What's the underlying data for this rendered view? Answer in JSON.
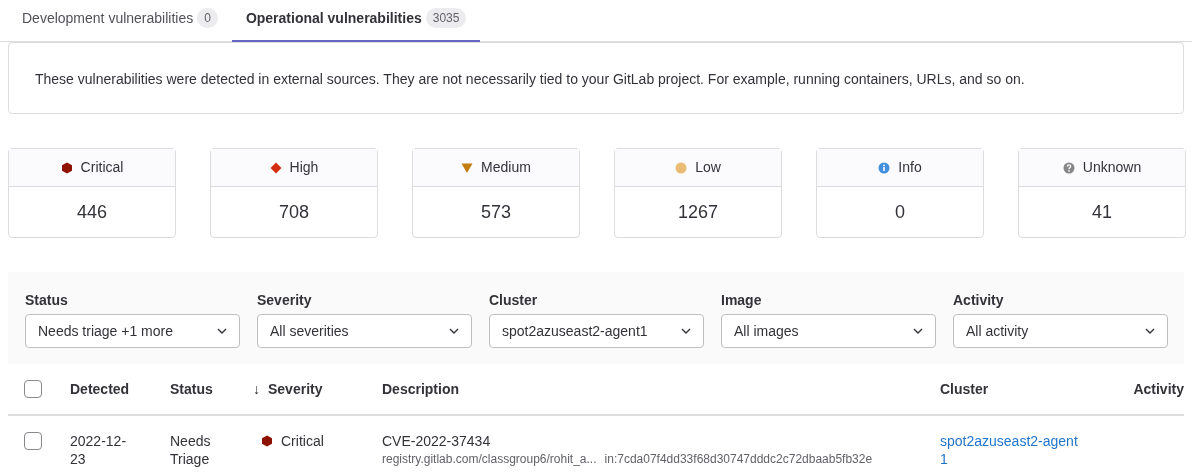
{
  "tabs": [
    {
      "label": "Development vulnerabilities",
      "count": "0",
      "selected": false
    },
    {
      "label": "Operational vulnerabilities",
      "count": "3035",
      "selected": true
    }
  ],
  "info_text": "These vulnerabilities were detected in external sources. They are not necessarily tied to your GitLab project. For example, running containers, URLs, and so on.",
  "severity_counts": [
    {
      "kind": "critical",
      "label": "Critical",
      "count": "446",
      "color": "#8d1300"
    },
    {
      "kind": "high",
      "label": "High",
      "count": "708",
      "color": "#d42e11"
    },
    {
      "kind": "medium",
      "label": "Medium",
      "count": "573",
      "color": "#c17d10"
    },
    {
      "kind": "low",
      "label": "Low",
      "count": "1267",
      "color": "#e9be74"
    },
    {
      "kind": "info",
      "label": "Info",
      "count": "0",
      "color": "#428fdc"
    },
    {
      "kind": "unknown",
      "label": "Unknown",
      "count": "41",
      "color": "#868686"
    }
  ],
  "filters": [
    {
      "label": "Status",
      "value": "Needs triage +1 more"
    },
    {
      "label": "Severity",
      "value": "All severities"
    },
    {
      "label": "Cluster",
      "value": "spot2azuseast2-agent1"
    },
    {
      "label": "Image",
      "value": "All images"
    },
    {
      "label": "Activity",
      "value": "All activity"
    }
  ],
  "table": {
    "select_all_checked": false,
    "columns": [
      "Detected",
      "Status",
      "Severity",
      "Description",
      "Cluster",
      "Activity"
    ],
    "sort_arrow": "↓",
    "rows": [
      {
        "checked": false,
        "detected": "2022-12-23",
        "status": "Needs Triage",
        "severity": {
          "kind": "critical",
          "label": "Critical",
          "color": "#8d1300"
        },
        "title": "CVE-2022-37434",
        "location": "registry.gitlab.com/classgroup6/rohit_a...",
        "image_ref": "in:7cda07f4dd33f68d30747dddc2c72dbaab5fb32e",
        "cluster": "spot2azuseast2-agent1"
      }
    ]
  }
}
